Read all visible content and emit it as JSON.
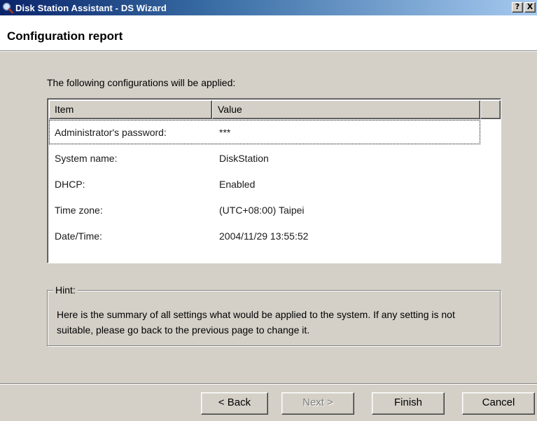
{
  "window": {
    "title": "Disk Station Assistant - DS Wizard",
    "help_button": "?",
    "close_button": "X"
  },
  "header": {
    "title": "Configuration report"
  },
  "intro": "The following configurations will be applied:",
  "table": {
    "columns": [
      "Item",
      "Value"
    ],
    "rows": [
      {
        "item": "Administrator's password:",
        "value": "***"
      },
      {
        "item": "System name:",
        "value": "DiskStation"
      },
      {
        "item": "DHCP:",
        "value": "Enabled"
      },
      {
        "item": "Time zone:",
        "value": "(UTC+08:00) Taipei"
      },
      {
        "item": "Date/Time:",
        "value": "2004/11/29 13:55:52"
      }
    ]
  },
  "hint": {
    "label": "Hint:",
    "text": "Here is the summary of all settings what would be applied to the system. If any setting is not suitable, please go back to the previous page to change it."
  },
  "buttons": {
    "back": "< Back",
    "next": "Next >",
    "finish": "Finish",
    "cancel": "Cancel"
  },
  "colors": {
    "titlebar_start": "#0a246a",
    "titlebar_end": "#a6caf0",
    "dialog_face": "#d4d0c8"
  }
}
